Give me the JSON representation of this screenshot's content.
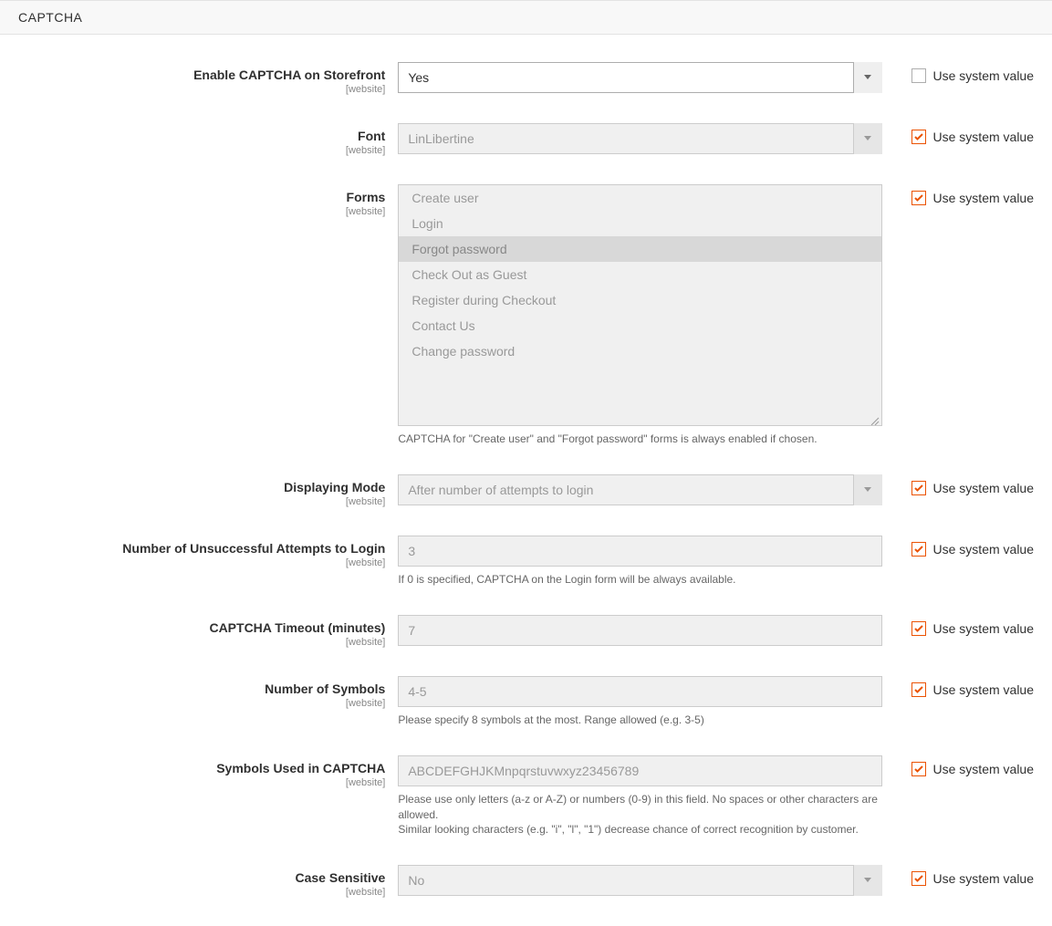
{
  "section": {
    "title": "CAPTCHA"
  },
  "systemValueLabel": "Use system value",
  "fields": {
    "enable": {
      "label": "Enable CAPTCHA on Storefront",
      "scope": "[website]",
      "value": "Yes",
      "useSystem": false,
      "disabled": false
    },
    "font": {
      "label": "Font",
      "scope": "[website]",
      "value": "LinLibertine",
      "useSystem": true,
      "disabled": true
    },
    "forms": {
      "label": "Forms",
      "scope": "[website]",
      "options": [
        {
          "label": "Create user",
          "selected": false
        },
        {
          "label": "Login",
          "selected": false
        },
        {
          "label": "Forgot password",
          "selected": true
        },
        {
          "label": "Check Out as Guest",
          "selected": false
        },
        {
          "label": "Register during Checkout",
          "selected": false
        },
        {
          "label": "Contact Us",
          "selected": false
        },
        {
          "label": "Change password",
          "selected": false
        }
      ],
      "hint": "CAPTCHA for \"Create user\" and \"Forgot password\" forms is always enabled if chosen.",
      "useSystem": true,
      "disabled": true
    },
    "displayingMode": {
      "label": "Displaying Mode",
      "scope": "[website]",
      "value": "After number of attempts to login",
      "useSystem": true,
      "disabled": true
    },
    "numAttempts": {
      "label": "Number of Unsuccessful Attempts to Login",
      "scope": "[website]",
      "value": "3",
      "hint": "If 0 is specified, CAPTCHA on the Login form will be always available.",
      "useSystem": true,
      "disabled": true
    },
    "timeout": {
      "label": "CAPTCHA Timeout (minutes)",
      "scope": "[website]",
      "value": "7",
      "useSystem": true,
      "disabled": true
    },
    "numSymbols": {
      "label": "Number of Symbols",
      "scope": "[website]",
      "value": "4-5",
      "hint": "Please specify 8 symbols at the most. Range allowed (e.g. 3-5)",
      "useSystem": true,
      "disabled": true
    },
    "symbolsUsed": {
      "label": "Symbols Used in CAPTCHA",
      "scope": "[website]",
      "value": "ABCDEFGHJKMnpqrstuvwxyz23456789",
      "hint": "Please use only letters (a-z or A-Z) or numbers (0-9) in this field. No spaces or other characters are allowed.\nSimilar looking characters (e.g. \"i\", \"l\", \"1\") decrease chance of correct recognition by customer.",
      "useSystem": true,
      "disabled": true
    },
    "caseSensitive": {
      "label": "Case Sensitive",
      "scope": "[website]",
      "value": "No",
      "useSystem": true,
      "disabled": true
    }
  }
}
